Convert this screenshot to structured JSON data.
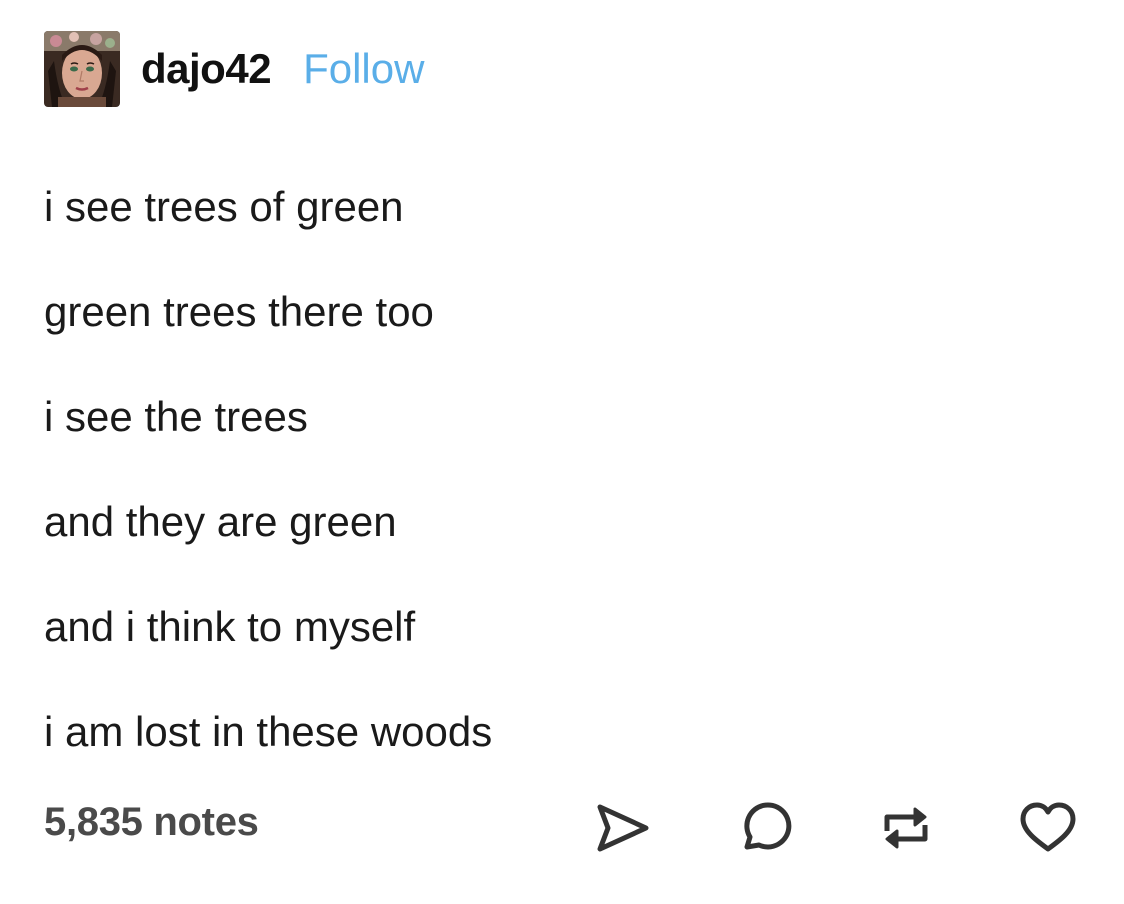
{
  "post": {
    "author": {
      "username": "dajo42",
      "follow_label": "Follow",
      "avatar_icon": "user-avatar"
    },
    "lines": [
      "i see trees of green",
      "green trees there too",
      "i see the trees",
      "and they are green",
      "and i think to myself",
      "i am lost in these woods"
    ],
    "notes_label": "5,835 notes",
    "actions": [
      {
        "name": "share",
        "icon": "share-icon"
      },
      {
        "name": "reply",
        "icon": "reply-icon"
      },
      {
        "name": "reblog",
        "icon": "reblog-icon"
      },
      {
        "name": "like",
        "icon": "heart-icon"
      }
    ]
  },
  "colors": {
    "follow": "#5aaee8",
    "text": "#1a1a1a",
    "notes": "#4a4a4a",
    "icons": "#333333"
  }
}
